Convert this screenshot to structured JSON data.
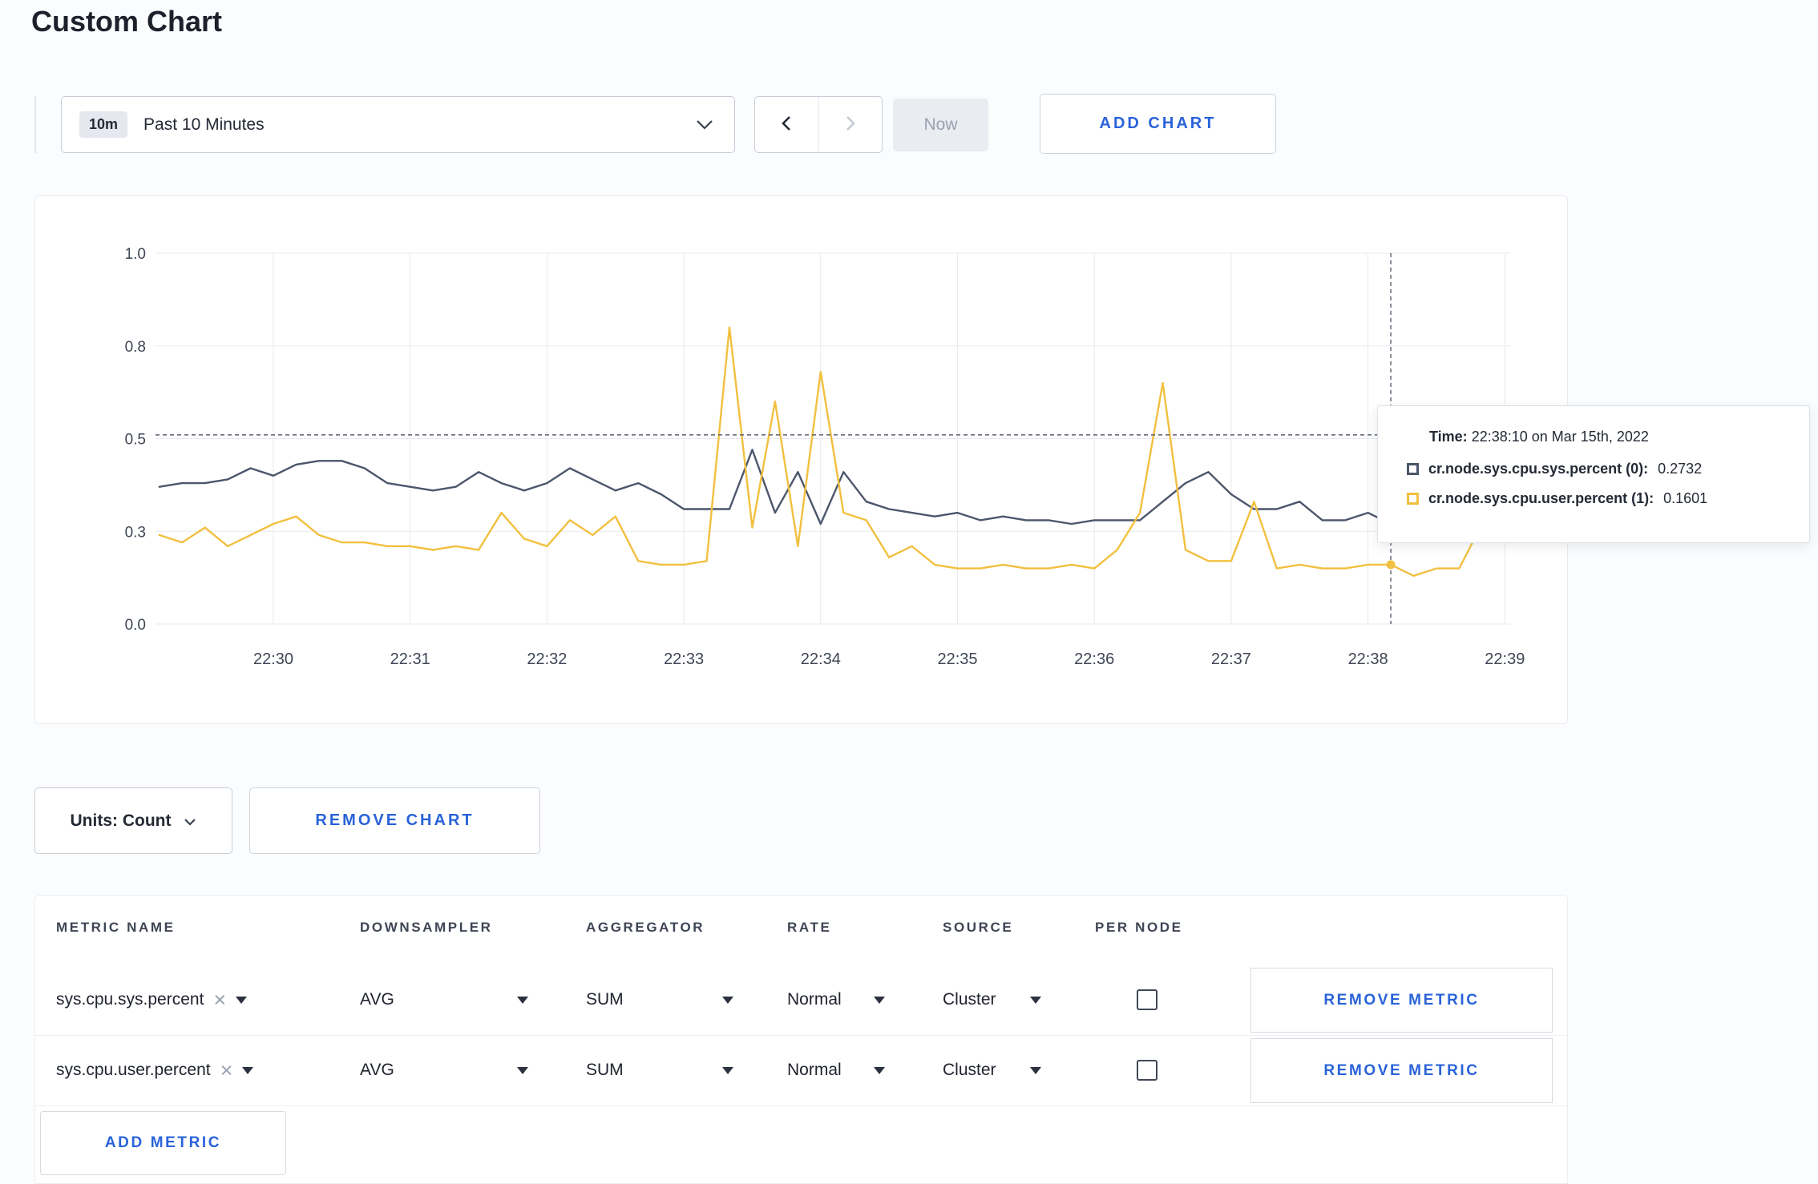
{
  "page": {
    "title": "Custom Chart"
  },
  "icons": {
    "chevron_down": "⌄",
    "chevron_left": "‹",
    "chevron_right": "›",
    "close": "×",
    "caret_down": "▾"
  },
  "toolbar": {
    "time_badge": "10m",
    "time_range_label": "Past 10 Minutes",
    "now_label": "Now",
    "add_chart_label": "ADD CHART"
  },
  "chart": {
    "tooltip": {
      "time_label": "Time:",
      "time_value": "22:38:10 on Mar 15th, 2022",
      "series": [
        {
          "label": "cr.node.sys.cpu.sys.percent (0):",
          "value": "0.2732",
          "color": "#4c566c"
        },
        {
          "label": "cr.node.sys.cpu.user.percent (1):",
          "value": "0.1601",
          "color": "#f2c040"
        }
      ]
    }
  },
  "chart_data": {
    "type": "line",
    "title": "",
    "x_ticks": [
      "22:30",
      "22:31",
      "22:32",
      "22:33",
      "22:34",
      "22:35",
      "22:36",
      "22:37",
      "22:38",
      "22:39"
    ],
    "y_tick_values": [
      0,
      0.25,
      0.5,
      0.75,
      1
    ],
    "y_tick_labels": [
      "0.0",
      "0.3",
      "0.5",
      "0.8",
      "1.0"
    ],
    "ylim": [
      0,
      1
    ],
    "grid": true,
    "x_start_min": -0.8333,
    "x_step_min": 0.16667,
    "series": [
      {
        "name": "cr.node.sys.cpu.sys.percent",
        "color": "#4c566c",
        "values": [
          0.37,
          0.38,
          0.38,
          0.39,
          0.42,
          0.4,
          0.43,
          0.44,
          0.44,
          0.42,
          0.38,
          0.37,
          0.36,
          0.37,
          0.41,
          0.38,
          0.36,
          0.38,
          0.42,
          0.39,
          0.36,
          0.38,
          0.35,
          0.31,
          0.31,
          0.31,
          0.47,
          0.3,
          0.41,
          0.27,
          0.41,
          0.33,
          0.31,
          0.3,
          0.29,
          0.3,
          0.28,
          0.29,
          0.28,
          0.28,
          0.27,
          0.28,
          0.28,
          0.28,
          0.33,
          0.38,
          0.41,
          0.35,
          0.31,
          0.31,
          0.33,
          0.28,
          0.28,
          0.3,
          0.27,
          0.32,
          0.3,
          0.3,
          0.31,
          0.3
        ]
      },
      {
        "name": "cr.node.sys.cpu.user.percent",
        "color": "#f2c040",
        "values": [
          0.24,
          0.22,
          0.26,
          0.21,
          0.24,
          0.27,
          0.29,
          0.24,
          0.22,
          0.22,
          0.21,
          0.21,
          0.2,
          0.21,
          0.2,
          0.3,
          0.23,
          0.21,
          0.28,
          0.24,
          0.29,
          0.17,
          0.16,
          0.16,
          0.17,
          0.8,
          0.26,
          0.6,
          0.21,
          0.68,
          0.3,
          0.28,
          0.18,
          0.21,
          0.16,
          0.15,
          0.15,
          0.16,
          0.15,
          0.15,
          0.16,
          0.15,
          0.2,
          0.3,
          0.65,
          0.2,
          0.17,
          0.17,
          0.33,
          0.15,
          0.16,
          0.15,
          0.15,
          0.16,
          0.16,
          0.13,
          0.15,
          0.15,
          0.27,
          0.23
        ]
      }
    ],
    "crosshair": {
      "time_min_from_2230": 8.1667,
      "hline_value": 0.51,
      "point_values": [
        0.2732,
        0.1601
      ]
    }
  },
  "chart_controls": {
    "units_label": "Units: Count",
    "remove_chart_label": "REMOVE CHART"
  },
  "metrics_table": {
    "headers": [
      "METRIC NAME",
      "DOWNSAMPLER",
      "AGGREGATOR",
      "RATE",
      "SOURCE",
      "PER NODE"
    ],
    "rows": [
      {
        "metric": "sys.cpu.sys.percent",
        "downsampler": "AVG",
        "aggregator": "SUM",
        "rate": "Normal",
        "source": "Cluster",
        "per_node": false,
        "remove_label": "REMOVE METRIC"
      },
      {
        "metric": "sys.cpu.user.percent",
        "downsampler": "AVG",
        "aggregator": "SUM",
        "rate": "Normal",
        "source": "Cluster",
        "per_node": false,
        "remove_label": "REMOVE METRIC"
      }
    ],
    "add_metric_label": "ADD METRIC"
  }
}
